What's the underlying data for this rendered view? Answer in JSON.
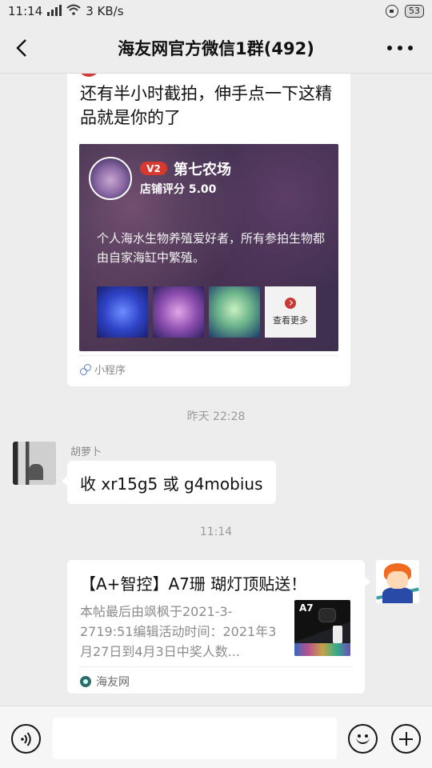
{
  "status_bar": {
    "time": "11:14",
    "network": "3G",
    "speed": "3 KB/s",
    "battery": "53",
    "icons": [
      "signal-icon",
      "wifi-icon",
      "lock-icon",
      "battery-icon"
    ]
  },
  "header": {
    "title": "海友网官方微信1群(492)",
    "back_icon": "chevron-left-icon",
    "more_icon": "more-dots-icon"
  },
  "messages": {
    "miniapp": {
      "text": "还有半小时截拍，伸手点一下这精品就是你的了",
      "vip_badge": "V2",
      "shop_name": "第七农场",
      "shop_score": "店铺评分 5.00",
      "shop_desc": "个人海水生物养殖爱好者，所有参拍生物都由自家海缸中繁殖。",
      "more_label": "查看更多",
      "footer_label": "小程序"
    },
    "timestamp_1": "昨天 22:28",
    "text_message": {
      "sender": "胡萝卜",
      "text": "收 xr15g5 或 g4mobius"
    },
    "timestamp_2": "11:14",
    "link_card": {
      "title": "【A+智控】A7珊 瑚灯顶贴送！",
      "description": "本帖最后由飒枫于2021-3-2719:51编辑活动时间：2021年3月27日到4月3日中奖人数...",
      "thumb_label": "A7",
      "source": "海友网"
    }
  },
  "input_bar": {
    "placeholder": "",
    "voice_icon": "voice-icon",
    "emoji_icon": "emoji-icon",
    "plus_icon": "plus-icon"
  },
  "colors": {
    "background": "#ededed",
    "bubble": "#ffffff",
    "accent_red": "#d8392f"
  }
}
